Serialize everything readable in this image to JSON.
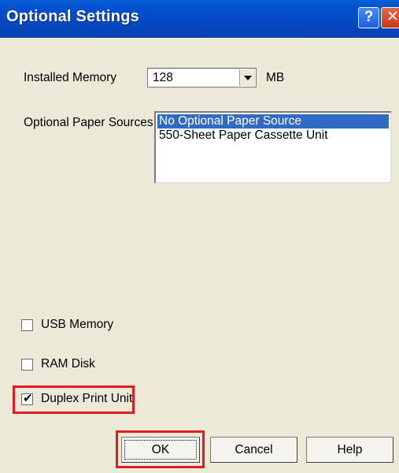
{
  "window": {
    "title": "Optional Settings",
    "help_icon": "?",
    "close_icon": "✕"
  },
  "memory": {
    "label": "Installed Memory",
    "value": "128",
    "unit": "MB"
  },
  "paper_sources": {
    "label": "Optional Paper Sources",
    "items": [
      {
        "label": "No Optional Paper Source",
        "selected": true
      },
      {
        "label": "550-Sheet Paper Cassette Unit",
        "selected": false
      }
    ]
  },
  "options": [
    {
      "label": "USB Memory",
      "checked": false
    },
    {
      "label": "RAM Disk",
      "checked": false
    },
    {
      "label": "Duplex Print Unit",
      "checked": true
    }
  ],
  "buttons": {
    "ok": "OK",
    "cancel": "Cancel",
    "help": "Help"
  },
  "colors": {
    "titlebar": "#0449c4",
    "selection": "#316ac5",
    "highlight": "#e21c23",
    "dialog_bg": "#ece9d8"
  }
}
